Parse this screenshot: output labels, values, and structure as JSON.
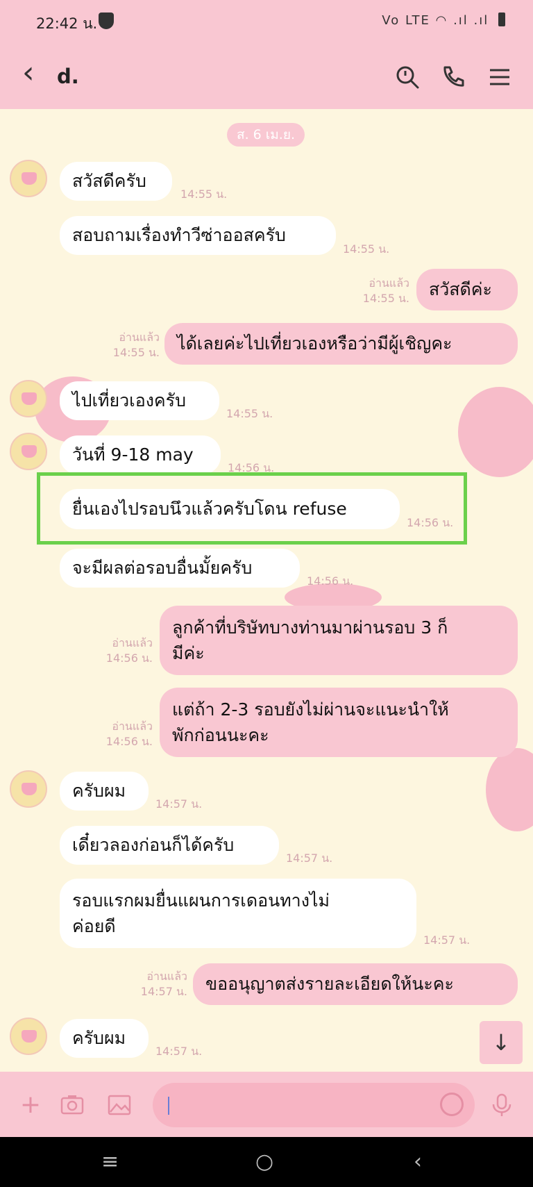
{
  "status": {
    "time": "22:42 น.",
    "network": "Vo LTE",
    "battery": ""
  },
  "header": {
    "title": "d."
  },
  "date": "ส. 6 เม.ย.",
  "messages": [
    {
      "text": "สวัสดีครับ",
      "time": "14:55 น."
    },
    {
      "text": "สอบถามเรื่องทำวีซ่าออสครับ",
      "time": "14:55 น."
    },
    {
      "text": "สวัสดีค่ะ",
      "time": "14:55 น.",
      "read": "อ่านแล้ว"
    },
    {
      "text": "ได้เลยค่ะไปเที่ยวเองหรือว่ามีผู้เชิญคะ",
      "time": "14:55 น.",
      "read": "อ่านแล้ว"
    },
    {
      "text": "ไปเที่ยวเองครับ",
      "time": "14:55 น."
    },
    {
      "text": "วันที่ 9-18 may",
      "time": "14:56 น."
    },
    {
      "text": "ยื่นเองไปรอบนึวแล้วครับโดน refuse",
      "time": "14:56 น."
    },
    {
      "text": "จะมีผลต่อรอบอื่นมั้ยครับ",
      "time": "14:56 น."
    },
    {
      "line1": "ลูกค้าที่บริษัทบางท่านมาผ่านรอบ 3 ก็",
      "line2": "มีค่ะ",
      "time": "14:56 น.",
      "read": "อ่านแล้ว"
    },
    {
      "line1": "แต่ถ้า 2-3 รอบยังไม่ผ่านจะแนะนำให้",
      "line2": "พักก่อนนะคะ",
      "time": "14:56 น.",
      "read": "อ่านแล้ว"
    },
    {
      "text": "ครับผม",
      "time": "14:57 น."
    },
    {
      "text": "เดี๋ยวลองก่อนก็ได้ครับ",
      "time": "14:57 น."
    },
    {
      "line1": "รอบแรกผมยื่นแผนการเดอนทางไม่",
      "line2": "ค่อยดี",
      "time": "14:57 น."
    },
    {
      "text": "ขออนุญาตส่งรายละเอียดให้นะคะ",
      "time": "14:57 น.",
      "read": "อ่านแล้ว"
    },
    {
      "text": "ครับผม",
      "time": "14:57 น."
    }
  ],
  "input": {
    "placeholder": ""
  }
}
